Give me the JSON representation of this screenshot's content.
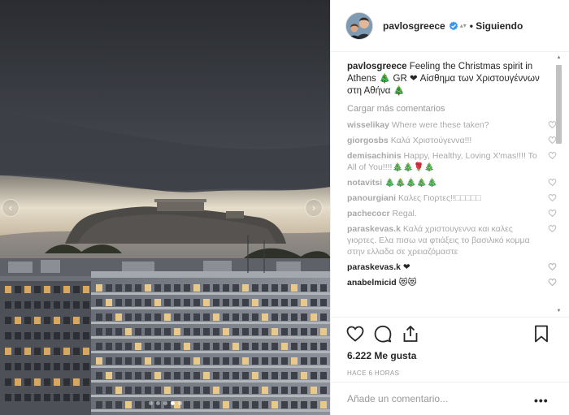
{
  "post": {
    "username": "pavlosgreece",
    "follow_status": "• Siguiendo",
    "caption_user": "pavlosgreece",
    "caption_text": " Feeling the Christmas spirit in Athens 🎄 GR ❤ Αίσθημα των Χριστουγέννων στη Αθήνα 🎄",
    "load_more": "Cargar más comentarios",
    "comments": [
      {
        "user": "wisselikay",
        "text": "Where were these taken?"
      },
      {
        "user": "giorgosbs",
        "text": "Καλά Χριστούγεννα!!!"
      },
      {
        "user": "demisachinis",
        "text": "Happy, Healthy, Loving X'mas!!!! To All of You!!!!🎄🎄🌹🎄"
      },
      {
        "user": "notavitsi",
        "text": "🎄🎄🎄🎄🎄"
      },
      {
        "user": "panourgiani",
        "text": "Καλες Γιορτες!!□□□□□"
      },
      {
        "user": "pachecocr",
        "text": "Regal."
      },
      {
        "user": "paraskevas.k",
        "text": "Καλά χριστουγεννα και καλες γιορτες. Ελα πισω να φτιάξεις το βασιλικό κομμα στην ελλαδα σε χρειαζόμαστε"
      },
      {
        "user": "paraskevas.k",
        "text": "❤"
      },
      {
        "user": "anabelmicid",
        "text": "😻😻"
      }
    ],
    "likes": "6.222 Me gusta",
    "timestamp": "HACE 6 HORAS",
    "add_comment_placeholder": "Añade un comentario...",
    "more_options": "•••",
    "carousel": {
      "count": 5,
      "active_index": 3
    },
    "icons": {
      "like": "heart-icon",
      "comment": "comment-icon",
      "share": "share-icon",
      "save": "bookmark-icon",
      "verified": "verified-badge-icon",
      "prev": "chevron-left-icon",
      "next": "chevron-right-icon"
    },
    "colors": {
      "verified": "#3897f0",
      "text": "#262626",
      "muted": "#999999"
    }
  }
}
